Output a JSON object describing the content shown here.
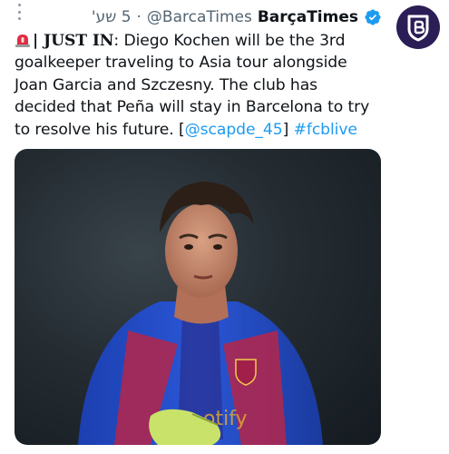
{
  "tweet": {
    "time": "5 שע'",
    "dot": "·",
    "handle": "@BarcaTimes",
    "display_name": "BarçaTimes",
    "alert_label": "| JUST IN",
    "text_main": ": Diego Kochen will be the 3rd goalkeeper traveling to Asia tour alongside Joan Garcia and Szczesny. The club has decided that Peña will stay in Barcelona to try to resolve his future. [",
    "mention": "@scapde_45",
    "close_bracket": "]",
    "hashtag": "#fcblive"
  },
  "icons": {
    "more": "more-vertical-icon",
    "verified": "verified-badge-icon",
    "alert": "rotating-light-icon",
    "avatar": "barcatimes-logo"
  },
  "colors": {
    "link": "#1d9bf0",
    "verified": "#1d9bf0",
    "avatar_bg": "#2b1d55",
    "secondary_text": "#536471"
  }
}
